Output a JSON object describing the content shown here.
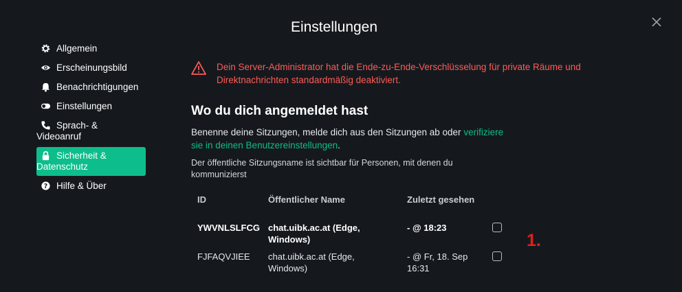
{
  "dialog": {
    "title": "Einstellungen"
  },
  "sidebar": {
    "items": [
      {
        "label": "Allgemein",
        "icon": "gear-icon"
      },
      {
        "label": "Erscheinungsbild",
        "icon": "eye-icon"
      },
      {
        "label": "Benachrichtigungen",
        "icon": "bell-icon"
      },
      {
        "label": "Einstellungen",
        "icon": "toggle-icon"
      },
      {
        "label": "Sprach- &\nVideoanruf",
        "icon": "phone-icon"
      },
      {
        "label": "Sicherheit &\nDatenschutz",
        "icon": "lock-icon",
        "active": true
      },
      {
        "label": "Hilfe & Über",
        "icon": "help-icon"
      }
    ]
  },
  "main": {
    "warning": "Dein Server-Administrator hat die Ende-zu-Ende-Verschlüsselung für private Räume und Direktnachrichten standardmäßig deaktiviert.",
    "heading": "Wo du dich angemeldet hast",
    "description": "Benenne deine Sitzungen, melde dich aus den Sitzungen ab oder",
    "description_link": "verifiziere sie in deinen Benutzereinstellungen",
    "description_end": ".",
    "public_note": "Der öffentliche Sitzungsname ist sichtbar für Personen, mit denen du kommunizierst",
    "table": {
      "headers": [
        "ID",
        "Öffentlicher Name",
        "Zuletzt gesehen"
      ],
      "rows": [
        {
          "id": "YWVNLSLFCG",
          "name": "chat.uibk.ac.at (Edge, Windows)",
          "last_seen": "- @ 18:23",
          "current": true
        },
        {
          "id": "FJFAQVJIEE",
          "name": "chat.uibk.ac.at (Edge, Windows)",
          "last_seen": "- @ Fr, 18. Sep 16:31",
          "current": false
        }
      ]
    }
  },
  "annotation": "1.",
  "colors": {
    "accent": "#0dbd8b",
    "warning": "#ff5b55",
    "background": "#15191e",
    "annotation": "#e02020"
  }
}
